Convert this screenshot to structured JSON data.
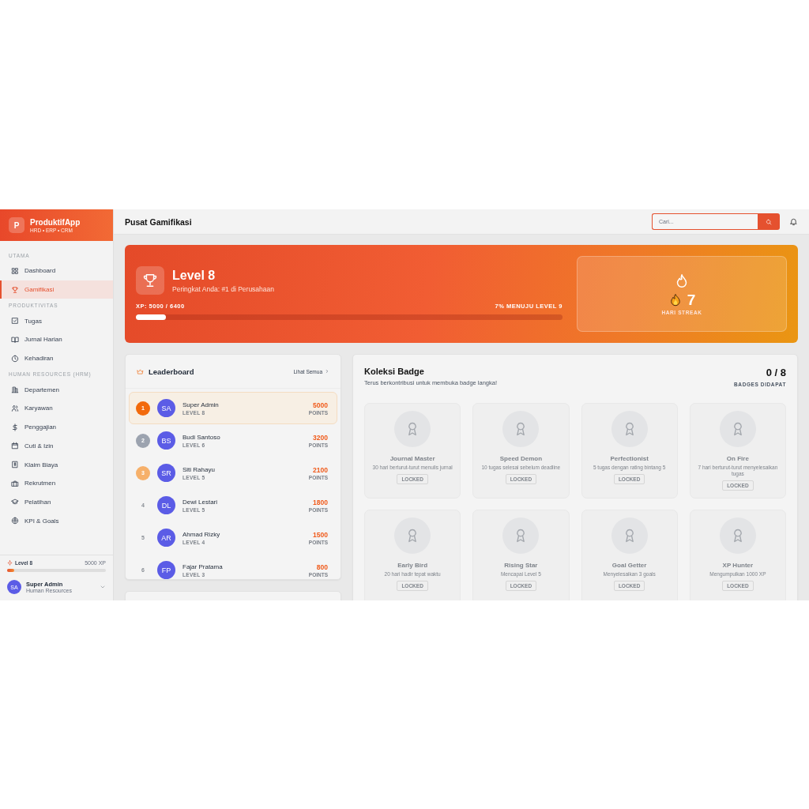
{
  "app": {
    "logo_letter": "P",
    "name": "ProduktifApp",
    "tagline": "HRD • ERP • CRM"
  },
  "sidebar": {
    "sections": [
      {
        "title": "UTAMA",
        "items": [
          {
            "label": "Dashboard",
            "selected": false
          },
          {
            "label": "Gamifikasi",
            "selected": true
          }
        ]
      },
      {
        "title": "PRODUKTIVITAS",
        "items": [
          {
            "label": "Tugas",
            "selected": false
          },
          {
            "label": "Jurnal Harian",
            "selected": false
          },
          {
            "label": "Kehadiran",
            "selected": false
          }
        ]
      },
      {
        "title": "HUMAN RESOURCES (HRM)",
        "items": [
          {
            "label": "Departemen",
            "selected": false
          },
          {
            "label": "Karyawan",
            "selected": false
          },
          {
            "label": "Penggajian",
            "selected": false
          },
          {
            "label": "Cuti & Izin",
            "selected": false
          },
          {
            "label": "Klaim Biaya",
            "selected": false
          },
          {
            "label": "Rekrutmen",
            "selected": false
          },
          {
            "label": "Pelatihan",
            "selected": false
          },
          {
            "label": "KPI & Goals",
            "selected": false
          }
        ]
      }
    ]
  },
  "sidebar_footer": {
    "level_label": "Level 8",
    "xp": "5000 XP",
    "level": 0.07,
    "user": {
      "initials": "SA",
      "name": "Super Admin",
      "role": "Human Resources"
    }
  },
  "header": {
    "title": "Pusat Gamifikasi",
    "search": {
      "placeholder": "Cari..."
    }
  },
  "hero": {
    "title": "Level 8",
    "subtitle": "Peringkat Anda: #1 di Perusahaan",
    "xp": "XP: 5000 / 6400",
    "next": "7% MENUJU LEVEL 9",
    "level": 0.07,
    "streak": {
      "value": "7",
      "label": "HARI STREAK"
    }
  },
  "leaderboard": {
    "title": "Leaderboard",
    "link": "Lihat Semua",
    "rows": [
      {
        "rank": "1",
        "color": "#f26a0c",
        "initials": "SA",
        "name": "Super Admin",
        "level_label": "LEVEL 8",
        "points": "5000",
        "points_label": "POINTS",
        "selected": true
      },
      {
        "rank": "2",
        "color": "#9ca3af",
        "initials": "BS",
        "name": "Budi Santoso",
        "level_label": "LEVEL 6",
        "points": "3200",
        "points_label": "POINTS",
        "selected": false
      },
      {
        "rank": "3",
        "color": "#f6b06a",
        "initials": "SR",
        "name": "Siti Rahayu",
        "level_label": "LEVEL 5",
        "points": "2100",
        "points_label": "POINTS",
        "selected": false
      },
      {
        "rank": "4",
        "initials": "DL",
        "name": "Dewi Lestari",
        "level_label": "LEVEL 5",
        "points": "1800",
        "points_label": "POINTS",
        "selected": false
      },
      {
        "rank": "5",
        "initials": "AR",
        "name": "Ahmad Rizky",
        "level_label": "LEVEL 4",
        "points": "1500",
        "points_label": "POINTS",
        "selected": false
      },
      {
        "rank": "6",
        "initials": "FP",
        "name": "Fajar Pratama",
        "level_label": "LEVEL 3",
        "points": "800",
        "points_label": "POINTS",
        "selected": false
      }
    ]
  },
  "badges": {
    "title": "Koleksi Badge",
    "subtitle": "Terus berkontribusi untuk membuka badge langka!",
    "count": "0 / 8",
    "count_label": "BADGES DIDAPAT",
    "items": [
      {
        "name": "Journal Master",
        "description": "30 hari berturut-turut menulis jurnal",
        "status": "LOCKED",
        "locked": true
      },
      {
        "name": "Speed Demon",
        "description": "10 tugas selesai sebelum deadline",
        "status": "LOCKED",
        "locked": true
      },
      {
        "name": "Perfectionist",
        "description": "5 tugas dengan rating bintang 5",
        "status": "LOCKED",
        "locked": true
      },
      {
        "name": "On Fire",
        "description": "7 hari berturut-turut menyelesaikan tugas",
        "status": "LOCKED",
        "locked": true
      },
      {
        "name": "Early Bird",
        "description": "20 hari hadir tepat waktu",
        "status": "LOCKED",
        "locked": true
      },
      {
        "name": "Rising Star",
        "description": "Mencapai Level 5",
        "status": "LOCKED",
        "locked": true
      },
      {
        "name": "Goal Getter",
        "description": "Menyelesaikan 3 goals",
        "status": "LOCKED",
        "locked": true
      },
      {
        "name": "XP Hunter",
        "description": "Mengumpulkan 1000 XP",
        "status": "LOCKED",
        "locked": true
      }
    ]
  }
}
